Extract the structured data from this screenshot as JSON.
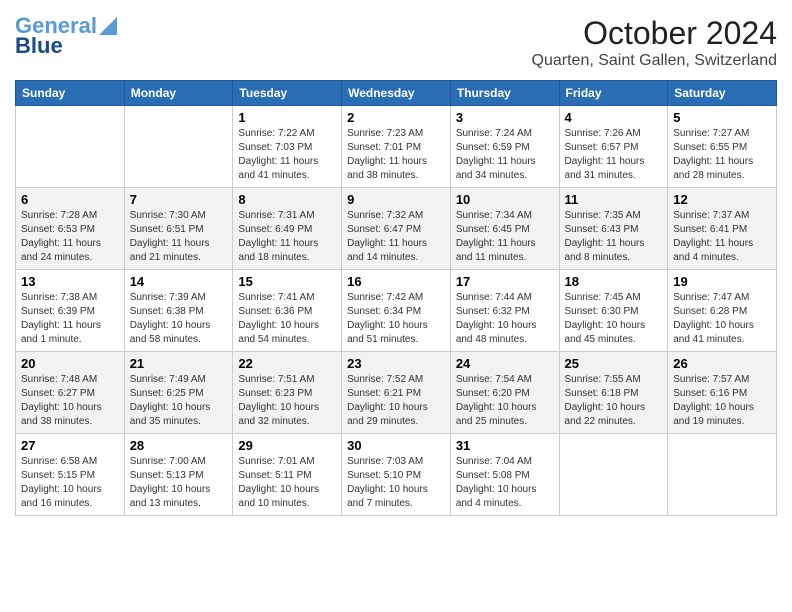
{
  "header": {
    "logo_line1": "General",
    "logo_line2": "Blue",
    "month": "October 2024",
    "location": "Quarten, Saint Gallen, Switzerland"
  },
  "weekdays": [
    "Sunday",
    "Monday",
    "Tuesday",
    "Wednesday",
    "Thursday",
    "Friday",
    "Saturday"
  ],
  "weeks": [
    {
      "shaded": false,
      "days": [
        {
          "num": "",
          "info": ""
        },
        {
          "num": "",
          "info": ""
        },
        {
          "num": "1",
          "info": "Sunrise: 7:22 AM\nSunset: 7:03 PM\nDaylight: 11 hours and 41 minutes."
        },
        {
          "num": "2",
          "info": "Sunrise: 7:23 AM\nSunset: 7:01 PM\nDaylight: 11 hours and 38 minutes."
        },
        {
          "num": "3",
          "info": "Sunrise: 7:24 AM\nSunset: 6:59 PM\nDaylight: 11 hours and 34 minutes."
        },
        {
          "num": "4",
          "info": "Sunrise: 7:26 AM\nSunset: 6:57 PM\nDaylight: 11 hours and 31 minutes."
        },
        {
          "num": "5",
          "info": "Sunrise: 7:27 AM\nSunset: 6:55 PM\nDaylight: 11 hours and 28 minutes."
        }
      ]
    },
    {
      "shaded": true,
      "days": [
        {
          "num": "6",
          "info": "Sunrise: 7:28 AM\nSunset: 6:53 PM\nDaylight: 11 hours and 24 minutes."
        },
        {
          "num": "7",
          "info": "Sunrise: 7:30 AM\nSunset: 6:51 PM\nDaylight: 11 hours and 21 minutes."
        },
        {
          "num": "8",
          "info": "Sunrise: 7:31 AM\nSunset: 6:49 PM\nDaylight: 11 hours and 18 minutes."
        },
        {
          "num": "9",
          "info": "Sunrise: 7:32 AM\nSunset: 6:47 PM\nDaylight: 11 hours and 14 minutes."
        },
        {
          "num": "10",
          "info": "Sunrise: 7:34 AM\nSunset: 6:45 PM\nDaylight: 11 hours and 11 minutes."
        },
        {
          "num": "11",
          "info": "Sunrise: 7:35 AM\nSunset: 6:43 PM\nDaylight: 11 hours and 8 minutes."
        },
        {
          "num": "12",
          "info": "Sunrise: 7:37 AM\nSunset: 6:41 PM\nDaylight: 11 hours and 4 minutes."
        }
      ]
    },
    {
      "shaded": false,
      "days": [
        {
          "num": "13",
          "info": "Sunrise: 7:38 AM\nSunset: 6:39 PM\nDaylight: 11 hours and 1 minute."
        },
        {
          "num": "14",
          "info": "Sunrise: 7:39 AM\nSunset: 6:38 PM\nDaylight: 10 hours and 58 minutes."
        },
        {
          "num": "15",
          "info": "Sunrise: 7:41 AM\nSunset: 6:36 PM\nDaylight: 10 hours and 54 minutes."
        },
        {
          "num": "16",
          "info": "Sunrise: 7:42 AM\nSunset: 6:34 PM\nDaylight: 10 hours and 51 minutes."
        },
        {
          "num": "17",
          "info": "Sunrise: 7:44 AM\nSunset: 6:32 PM\nDaylight: 10 hours and 48 minutes."
        },
        {
          "num": "18",
          "info": "Sunrise: 7:45 AM\nSunset: 6:30 PM\nDaylight: 10 hours and 45 minutes."
        },
        {
          "num": "19",
          "info": "Sunrise: 7:47 AM\nSunset: 6:28 PM\nDaylight: 10 hours and 41 minutes."
        }
      ]
    },
    {
      "shaded": true,
      "days": [
        {
          "num": "20",
          "info": "Sunrise: 7:48 AM\nSunset: 6:27 PM\nDaylight: 10 hours and 38 minutes."
        },
        {
          "num": "21",
          "info": "Sunrise: 7:49 AM\nSunset: 6:25 PM\nDaylight: 10 hours and 35 minutes."
        },
        {
          "num": "22",
          "info": "Sunrise: 7:51 AM\nSunset: 6:23 PM\nDaylight: 10 hours and 32 minutes."
        },
        {
          "num": "23",
          "info": "Sunrise: 7:52 AM\nSunset: 6:21 PM\nDaylight: 10 hours and 29 minutes."
        },
        {
          "num": "24",
          "info": "Sunrise: 7:54 AM\nSunset: 6:20 PM\nDaylight: 10 hours and 25 minutes."
        },
        {
          "num": "25",
          "info": "Sunrise: 7:55 AM\nSunset: 6:18 PM\nDaylight: 10 hours and 22 minutes."
        },
        {
          "num": "26",
          "info": "Sunrise: 7:57 AM\nSunset: 6:16 PM\nDaylight: 10 hours and 19 minutes."
        }
      ]
    },
    {
      "shaded": false,
      "days": [
        {
          "num": "27",
          "info": "Sunrise: 6:58 AM\nSunset: 5:15 PM\nDaylight: 10 hours and 16 minutes."
        },
        {
          "num": "28",
          "info": "Sunrise: 7:00 AM\nSunset: 5:13 PM\nDaylight: 10 hours and 13 minutes."
        },
        {
          "num": "29",
          "info": "Sunrise: 7:01 AM\nSunset: 5:11 PM\nDaylight: 10 hours and 10 minutes."
        },
        {
          "num": "30",
          "info": "Sunrise: 7:03 AM\nSunset: 5:10 PM\nDaylight: 10 hours and 7 minutes."
        },
        {
          "num": "31",
          "info": "Sunrise: 7:04 AM\nSunset: 5:08 PM\nDaylight: 10 hours and 4 minutes."
        },
        {
          "num": "",
          "info": ""
        },
        {
          "num": "",
          "info": ""
        }
      ]
    }
  ]
}
